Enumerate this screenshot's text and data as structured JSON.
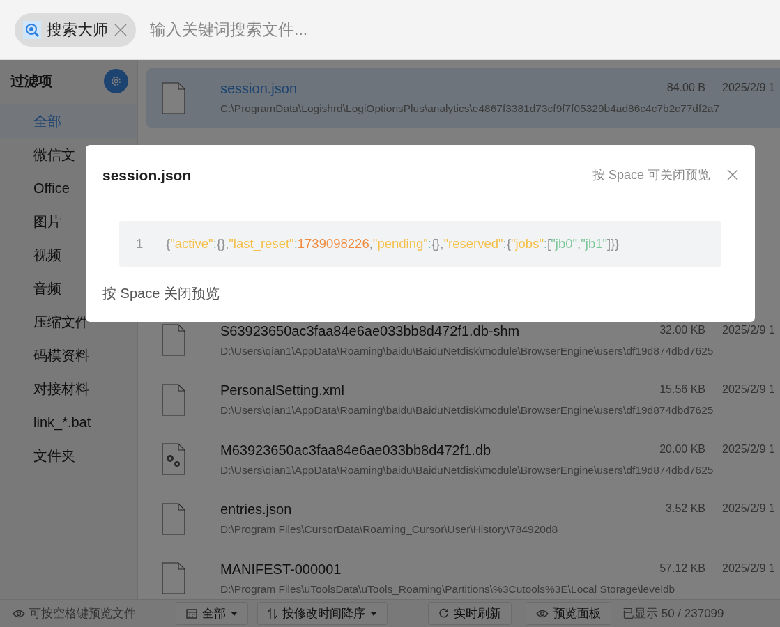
{
  "search_bar": {
    "tag": {
      "label": "搜索大师"
    },
    "placeholder": "输入关键词搜索文件..."
  },
  "sidebar": {
    "title": "过滤项",
    "items": [
      {
        "label": "全部",
        "selected": true
      },
      {
        "label": "微信文",
        "selected": false
      },
      {
        "label": "Office",
        "selected": false
      },
      {
        "label": "图片",
        "selected": false
      },
      {
        "label": "视频",
        "selected": false
      },
      {
        "label": "音频",
        "selected": false
      },
      {
        "label": "压缩文件",
        "selected": false
      },
      {
        "label": "码模资料",
        "selected": false
      },
      {
        "label": "对接材料",
        "selected": false
      },
      {
        "label": "link_*.bat",
        "selected": false
      },
      {
        "label": "文件夹",
        "selected": false
      }
    ]
  },
  "files": [
    {
      "kind": "file",
      "name": "session.json",
      "path": "C:\\ProgramData\\Logishrd\\LogiOptionsPlus\\analytics\\e4867f3381d73cf9f7f05329b4ad86c4c7b2c77df2a7",
      "size": "84.00 B",
      "date": "2025/2/9 1",
      "selected": true
    },
    {
      "kind": "file",
      "name": "S63923650ac3faa84e6ae033bb8d472f1.db-shm",
      "path": "D:\\Users\\qian1\\AppData\\Roaming\\baidu\\BaiduNetdisk\\module\\BrowserEngine\\users\\df19d874dbd7625",
      "size": "32.00 KB",
      "date": "2025/2/9 1",
      "selected": false
    },
    {
      "kind": "file",
      "name": "PersonalSetting.xml",
      "path": "D:\\Users\\qian1\\AppData\\Roaming\\baidu\\BaiduNetdisk\\module\\BrowserEngine\\users\\df19d874dbd7625",
      "size": "15.56 KB",
      "date": "2025/2/9 1",
      "selected": false
    },
    {
      "kind": "settings-file",
      "name": "M63923650ac3faa84e6ae033bb8d472f1.db",
      "path": "D:\\Users\\qian1\\AppData\\Roaming\\baidu\\BaiduNetdisk\\module\\BrowserEngine\\users\\df19d874dbd7625",
      "size": "20.00 KB",
      "date": "2025/2/9 1",
      "selected": false
    },
    {
      "kind": "file",
      "name": "entries.json",
      "path": "D:\\Program Files\\CursorData\\Roaming_Cursor\\User\\History\\784920d8",
      "size": "3.52 KB",
      "date": "2025/2/9 1",
      "selected": false
    },
    {
      "kind": "file",
      "name": "MANIFEST-000001",
      "path": "D:\\Program Files\\uToolsData\\uTools_Roaming\\Partitions\\%3Cutools%3E\\Local Storage\\leveldb",
      "size": "57.12 KB",
      "date": "2025/2/9 1",
      "selected": false
    }
  ],
  "status_bar": {
    "hint": "可按空格键预览文件",
    "filter": "全部",
    "sort": "按修改时间降序",
    "refresh": "实时刷新",
    "preview": "预览面板",
    "count": "已显示 50 / 237099"
  },
  "preview": {
    "title": "session.json",
    "hint": "按 Space 可关闭预览",
    "lines": [
      {
        "number": "1",
        "tokens": [
          {
            "kind": "punct",
            "text": "{"
          },
          {
            "kind": "key",
            "text": "\"active\""
          },
          {
            "kind": "colon",
            "text": ":"
          },
          {
            "kind": "punct",
            "text": "{}"
          },
          {
            "kind": "punct",
            "text": ","
          },
          {
            "kind": "key",
            "text": "\"last_reset\""
          },
          {
            "kind": "colon",
            "text": ":"
          },
          {
            "kind": "number",
            "text": "1739098226"
          },
          {
            "kind": "punct",
            "text": ","
          },
          {
            "kind": "key",
            "text": "\"pending\""
          },
          {
            "kind": "colon",
            "text": ":"
          },
          {
            "kind": "punct",
            "text": "{}"
          },
          {
            "kind": "punct",
            "text": ","
          },
          {
            "kind": "key",
            "text": "\"reserved\""
          },
          {
            "kind": "colon",
            "text": ":"
          },
          {
            "kind": "punct",
            "text": "{"
          },
          {
            "kind": "key",
            "text": "\"jobs\""
          },
          {
            "kind": "colon",
            "text": ":"
          },
          {
            "kind": "punct",
            "text": "["
          },
          {
            "kind": "string",
            "text": "\"jb0\""
          },
          {
            "kind": "punct",
            "text": ","
          },
          {
            "kind": "string",
            "text": "\"jb1\""
          },
          {
            "kind": "punct",
            "text": "]}}"
          }
        ]
      }
    ],
    "footer": "按 Space 关闭预览"
  }
}
